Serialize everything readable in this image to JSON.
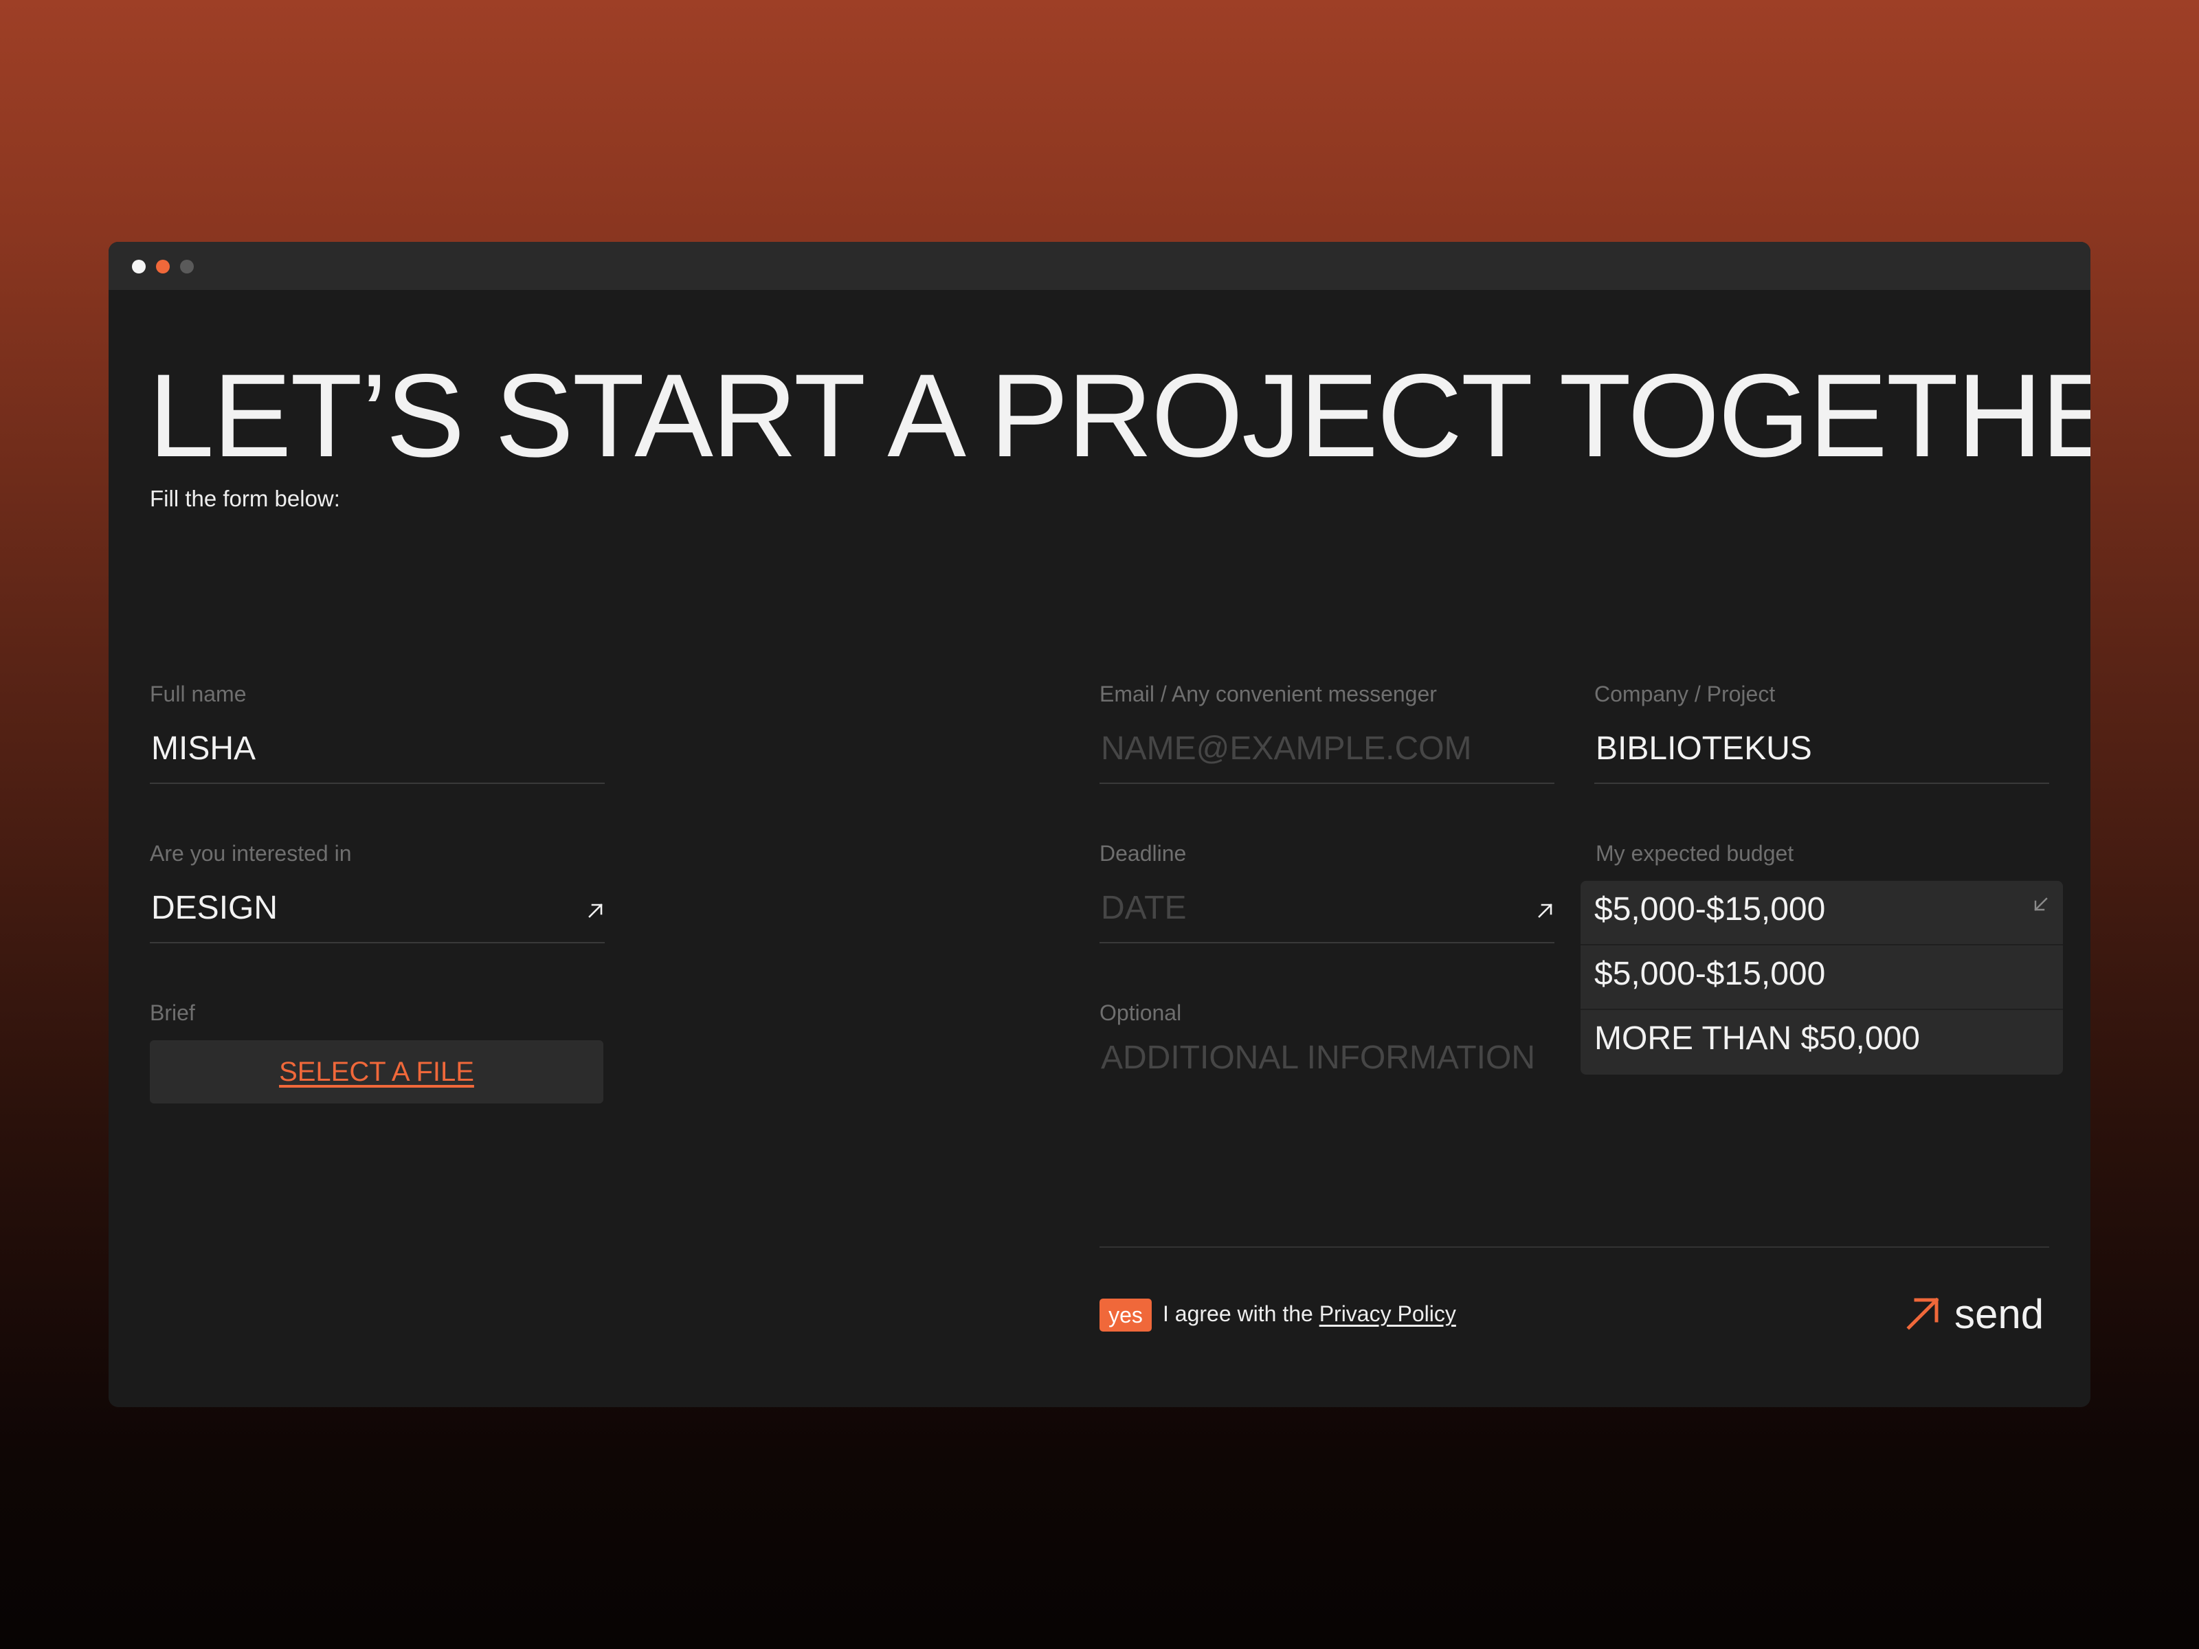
{
  "window": {
    "controls": [
      "close-dot",
      "minimize-dot",
      "zoom-dot"
    ]
  },
  "header": {
    "title": "LET’S START A PROJECT TOGETHER",
    "subtitle": "Fill the form below:"
  },
  "form": {
    "full_name": {
      "label": "Full name",
      "value": "MISHA"
    },
    "email": {
      "label": "Email / Any convenient messenger",
      "placeholder": "NAME@EXAMPLE.COM"
    },
    "company": {
      "label": "Company / Project",
      "value": "BIBLIOTEKUS"
    },
    "interest": {
      "label": "Are you interested in",
      "value": "DESIGN",
      "icon": "arrow-up-right-icon"
    },
    "deadline": {
      "label": "Deadline",
      "placeholder": "DATE",
      "icon": "arrow-up-right-icon"
    },
    "budget": {
      "label": "My expected budget",
      "selected": "$5,000-$15,000",
      "options": [
        "$5,000-$15,000",
        "MORE THAN $50,000"
      ],
      "icon": "arrow-down-left-icon"
    },
    "brief": {
      "label": "Brief",
      "button_label": "SELECT A FILE"
    },
    "optional": {
      "label": "Optional",
      "placeholder": "ADDITIONAL INFORMATION"
    }
  },
  "footer": {
    "consent_badge": "yes",
    "consent_text": "I agree with the ",
    "consent_link": "Privacy Policy",
    "send_label": "send",
    "send_icon": "arrow-up-right-icon"
  },
  "colors": {
    "accent": "#f0683a",
    "window_bg": "#1b1b1b",
    "titlebar_bg": "#2a2a2a",
    "text": "#f2f2f2",
    "label": "#6f6f6f",
    "placeholder": "#464646"
  }
}
